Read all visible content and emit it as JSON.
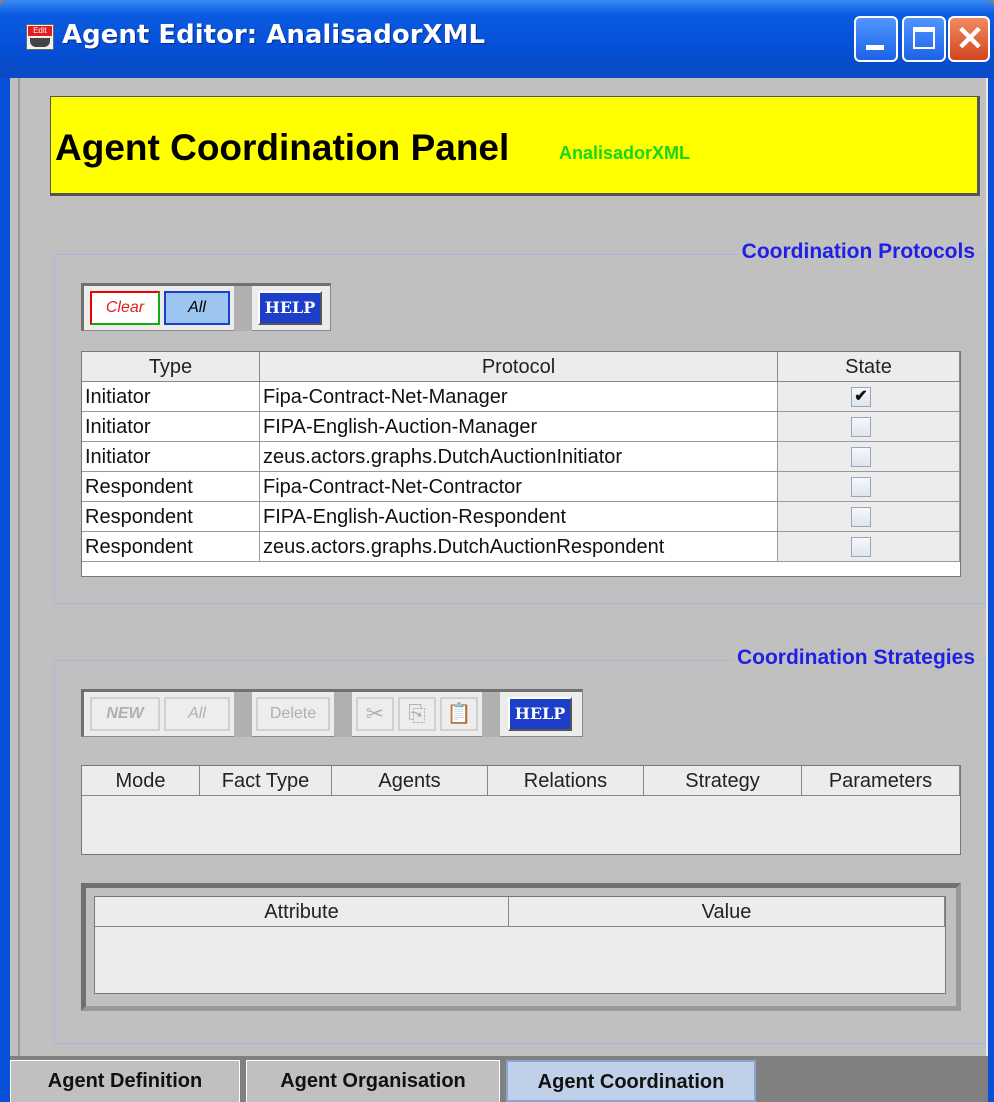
{
  "window": {
    "title": "Agent Editor: AnalisadorXML",
    "icon_label": "Edit",
    "close_glyph": "✕"
  },
  "banner": {
    "title": "Agent Coordination Panel",
    "agent_name": "AnalisadorXML"
  },
  "protocols": {
    "group_title": "Coordination Protocols",
    "toolbar": {
      "clear": "Clear",
      "all": "All",
      "help": "HELP"
    },
    "columns": [
      "Type",
      "Protocol",
      "State"
    ],
    "rows": [
      {
        "type": "Initiator",
        "protocol": "Fipa-Contract-Net-Manager",
        "state": true,
        "mark": "✔"
      },
      {
        "type": "Initiator",
        "protocol": "FIPA-English-Auction-Manager",
        "state": false,
        "mark": ""
      },
      {
        "type": "Initiator",
        "protocol": "zeus.actors.graphs.DutchAuctionInitiator",
        "state": false,
        "mark": ""
      },
      {
        "type": "Respondent",
        "protocol": "Fipa-Contract-Net-Contractor",
        "state": false,
        "mark": ""
      },
      {
        "type": "Respondent",
        "protocol": "FIPA-English-Auction-Respondent",
        "state": false,
        "mark": ""
      },
      {
        "type": "Respondent",
        "protocol": "zeus.actors.graphs.DutchAuctionRespondent",
        "state": false,
        "mark": ""
      }
    ]
  },
  "strategies": {
    "group_title": "Coordination Strategies",
    "toolbar": {
      "new": "NEW",
      "all": "All",
      "delete": "Delete",
      "cut": "✂",
      "copy": "⎘",
      "paste": "📋",
      "help": "HELP"
    },
    "columns": [
      "Mode",
      "Fact Type",
      "Agents",
      "Relations",
      "Strategy",
      "Parameters"
    ],
    "attr_columns": [
      "Attribute",
      "Value"
    ]
  },
  "tabs": [
    {
      "label": "Agent Definition",
      "active": false
    },
    {
      "label": "Agent Organisation",
      "active": false
    },
    {
      "label": "Agent Coordination",
      "active": true
    }
  ],
  "colors": {
    "banner": "#ffff00",
    "agent_name": "#17d517",
    "group_title": "#1f1fe6",
    "help_button": "#1d3ec8"
  }
}
